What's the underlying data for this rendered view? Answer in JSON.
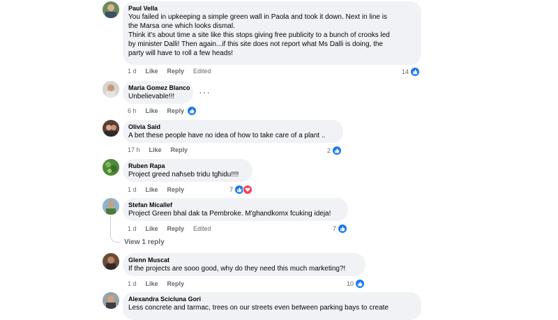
{
  "comments": [
    {
      "author": "Paul Vella",
      "text": "You failed in upkeeping a simple green wall in Paola and took it down. Next in line is\nthe Marsa one which looks dismal.\nThink it's about time a site like this stops giving free publicity to a bunch of crooks led\nby minister Dalli! Then again...if this site does not report what Ms Dalli is doing, the\nparty will have to roll a few heads!",
      "time": "1 d",
      "like": "Like",
      "reply": "Reply",
      "edited": "Edited",
      "reactions": "14"
    },
    {
      "author": "Maria Gomez Blanco",
      "text": "Unbelievable!!!",
      "time": "6 h",
      "like": "Like",
      "reply": "Reply",
      "more": "···"
    },
    {
      "author": "Olivia Said",
      "text": "A bet these people have no idea of how to take care of a plant ..",
      "time": "17 h",
      "like": "Like",
      "reply": "Reply",
      "reactions": "2"
    },
    {
      "author": "Ruben Rapa",
      "text": "Project greed naħseb tridu tgħidu!!!!",
      "time": "1 d",
      "like": "Like",
      "reply": "Reply",
      "reactions": "7"
    },
    {
      "author": "Stefan Micallef",
      "text": "Project Green bhal dak ta Pembroke. M'ghandkomx fcuking ideja!",
      "time": "1 d",
      "like": "Like",
      "reply": "Reply",
      "edited": "Edited",
      "reactions": "7",
      "view_replies": "View 1 reply"
    },
    {
      "author": "Glenn Muscat",
      "text": "If the projects are sooo good, why do they need this much marketing?!",
      "time": "1 d",
      "like": "Like",
      "reply": "Reply",
      "reactions": "10"
    },
    {
      "author": "Alexandra Scicluna Gori",
      "text": "Less concrete and tarmac, trees on our streets even between parking bays to create"
    }
  ],
  "colors": {
    "bubble": "#f0f2f5",
    "like_blue": "#1877f2",
    "love_red": "#f33e58",
    "meta_grey": "#65676b"
  },
  "icons": [
    "like-icon",
    "love-icon",
    "more-options-icon"
  ]
}
